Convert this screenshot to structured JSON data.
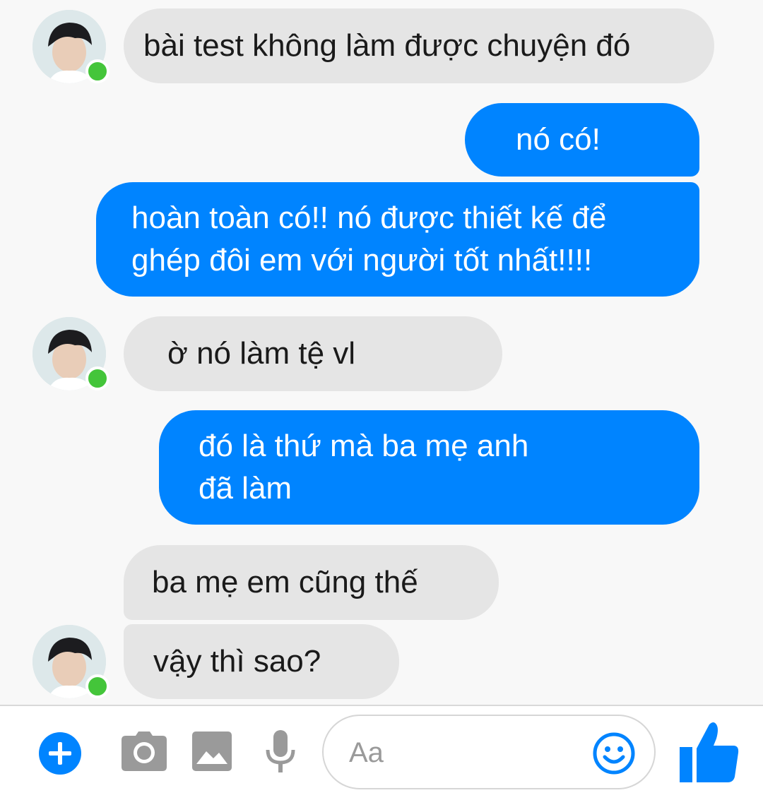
{
  "messages": [
    {
      "side": "them",
      "text": "bài test không làm được chuyện đó"
    },
    {
      "side": "me",
      "text": "nó có!"
    },
    {
      "side": "me",
      "lines": [
        "hoàn toàn có!! nó được thiết kế để",
        "ghép đôi em với người tốt nhất!!!!"
      ]
    },
    {
      "side": "them",
      "text": "ờ nó làm tệ vl"
    },
    {
      "side": "me",
      "lines": [
        "đó là thứ mà ba mẹ anh",
        "đã làm"
      ]
    },
    {
      "side": "them",
      "text": "ba mẹ em cũng thế"
    },
    {
      "side": "them",
      "text": "vậy thì sao?"
    }
  ],
  "composer": {
    "placeholder": "Aa",
    "icons": [
      "plus-icon",
      "camera-icon",
      "image-icon",
      "microphone-icon",
      "emoji-icon",
      "thumbs-up-icon"
    ]
  },
  "colors": {
    "sent_bubble": "#0084ff",
    "received_bubble": "#e5e5e5",
    "background": "#f8f8f8",
    "accent": "#0084ff",
    "icon_gray": "#9a9a9a",
    "online": "#44c53a"
  }
}
